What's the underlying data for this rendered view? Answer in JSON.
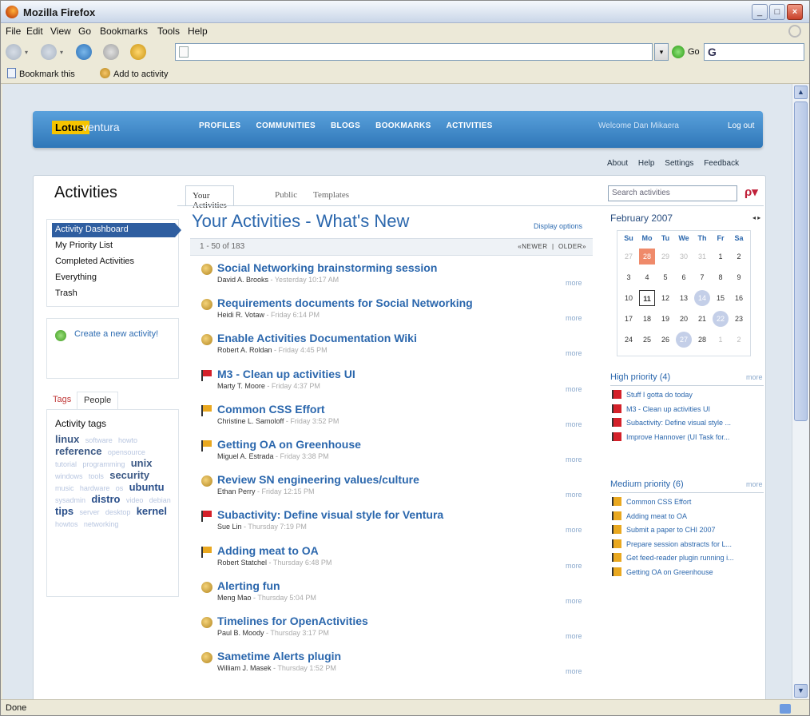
{
  "window": {
    "title": "Mozilla Firefox"
  },
  "menu": [
    "File",
    "Edit",
    "View",
    "Go",
    "Bookmarks",
    "Tools",
    "Help"
  ],
  "nav": {
    "url": "",
    "go_label": "Go",
    "search_glyph": "G"
  },
  "bookmarks": {
    "bookmark_this": "Bookmark this",
    "add_to_activity": "Add to activity"
  },
  "statusbar": {
    "text": "Done"
  },
  "site": {
    "logo_lotus": "Lotus.",
    "logo_product": "ventura",
    "topnav": [
      "PROFILES",
      "COMMUNITIES",
      "BLOGS",
      "BOOKMARKS",
      "ACTIVITIES"
    ],
    "welcome": "Welcome Dan Mikaera",
    "logout": "Log out",
    "util": [
      "About",
      "Help",
      "Settings",
      "Feedback"
    ]
  },
  "activities": {
    "title": "Activities",
    "tabs": [
      "Your Activities",
      "Public",
      "Templates"
    ],
    "search_placeholder": "Search activities",
    "leftnav": [
      "Activity Dashboard",
      "My Priority List",
      "Completed Activities",
      "Everything",
      "Trash"
    ],
    "create": "Create a new activity!",
    "tag_tabs": [
      "Tags",
      "People"
    ],
    "tags_heading": "Activity tags",
    "tags": [
      {
        "t": "linux",
        "w": 3
      },
      {
        "t": "software",
        "w": 1
      },
      {
        "t": "howto",
        "w": 1
      },
      {
        "t": "reference",
        "w": 3
      },
      {
        "t": "opensource",
        "w": 1
      },
      {
        "t": "tutorial",
        "w": 1
      },
      {
        "t": "programming",
        "w": 1
      },
      {
        "t": "unix",
        "w": 3
      },
      {
        "t": "windows",
        "w": 1
      },
      {
        "t": "tools",
        "w": 1
      },
      {
        "t": "security",
        "w": 3
      },
      {
        "t": "music",
        "w": 1
      },
      {
        "t": "hardware",
        "w": 1
      },
      {
        "t": "os",
        "w": 1
      },
      {
        "t": "ubuntu",
        "w": 2
      },
      {
        "t": "sysadmin",
        "w": 1
      },
      {
        "t": "distro",
        "w": 2
      },
      {
        "t": "video",
        "w": 1
      },
      {
        "t": "debian",
        "w": 1
      },
      {
        "t": "tips",
        "w": 2
      },
      {
        "t": "server",
        "w": 1
      },
      {
        "t": "desktop",
        "w": 1
      },
      {
        "t": "kernel",
        "w": 2
      },
      {
        "t": "howtos",
        "w": 1
      },
      {
        "t": "networking",
        "w": 1
      }
    ]
  },
  "main": {
    "title": "Your Activities - What's New",
    "display_options": "Display options",
    "range": "1 - 50 of 183",
    "newer": "«NEWER",
    "older": "OLDER»",
    "items": [
      {
        "icon": "globe",
        "title": "Social Networking brainstorming session",
        "author": "David A. Brooks",
        "time": "Yesterday 10:17 AM"
      },
      {
        "icon": "globe",
        "title": "Requirements documents for Social Networking",
        "author": "Heidi R. Votaw",
        "time": "Friday 6:14 PM"
      },
      {
        "icon": "globe",
        "title": "Enable Activities Documentation Wiki",
        "author": "Robert A. Roldan",
        "time": "Friday 4:45 PM"
      },
      {
        "icon": "redflag",
        "title": "M3 - Clean up activities UI",
        "author": "Marty T. Moore",
        "time": "Friday 4:37 PM"
      },
      {
        "icon": "yflag",
        "title": "Common CSS Effort",
        "author": "Christine L. Samoloff",
        "time": "Friday 3:52 PM"
      },
      {
        "icon": "yflag",
        "title": "Getting OA on Greenhouse",
        "author": "Miguel A. Estrada",
        "time": "Friday 3:38 PM"
      },
      {
        "icon": "globe",
        "title": "Review SN engineering values/culture",
        "author": "Ethan Perry",
        "time": "Friday 12:15 PM"
      },
      {
        "icon": "redflag",
        "title": "Subactivity: Define visual style for Ventura",
        "author": "Sue Lin",
        "time": "Thursday 7:19 PM"
      },
      {
        "icon": "yflag",
        "title": "Adding meat to OA",
        "author": "Robert Statchel",
        "time": "Thursday 6:48 PM"
      },
      {
        "icon": "globe",
        "title": "Alerting fun",
        "author": "Meng Mao",
        "time": "Thursday 5:04 PM"
      },
      {
        "icon": "globe",
        "title": "Timelines for OpenActivities",
        "author": "Paul B. Moody",
        "time": "Thursday 3:17 PM"
      },
      {
        "icon": "globe",
        "title": "Sametime Alerts plugin",
        "author": "William J. Masek",
        "time": "Thursday 1:52 PM"
      }
    ],
    "more_label": "more"
  },
  "calendar": {
    "month": "February 2007",
    "nav": "◂ ▸",
    "days": [
      "Su",
      "Mo",
      "Tu",
      "We",
      "Th",
      "Fr",
      "Sa"
    ],
    "weeks": [
      [
        "27",
        "28",
        "29",
        "30",
        "31",
        "1",
        "2"
      ],
      [
        "3",
        "4",
        "5",
        "6",
        "7",
        "8",
        "9"
      ],
      [
        "10",
        "11",
        "12",
        "13",
        "14",
        "15",
        "16"
      ],
      [
        "17",
        "18",
        "19",
        "20",
        "21",
        "22",
        "23"
      ],
      [
        "24",
        "25",
        "26",
        "27",
        "28",
        "1",
        "2"
      ]
    ]
  },
  "priority": {
    "high": {
      "title": "High priority (4)",
      "items": [
        "Stuff I gotta do today",
        "M3 - Clean up activities UI",
        "Subactivity: Define visual style ...",
        "Improve Hannover (UI Task for..."
      ]
    },
    "medium": {
      "title": "Medium priority (6)",
      "items": [
        "Common CSS Effort",
        "Adding meat to OA",
        "Submit a paper to CHI 2007",
        "Prepare session abstracts for L...",
        "Get feed-reader plugin running i...",
        "Getting OA on Greenhouse"
      ]
    },
    "more": "more"
  }
}
